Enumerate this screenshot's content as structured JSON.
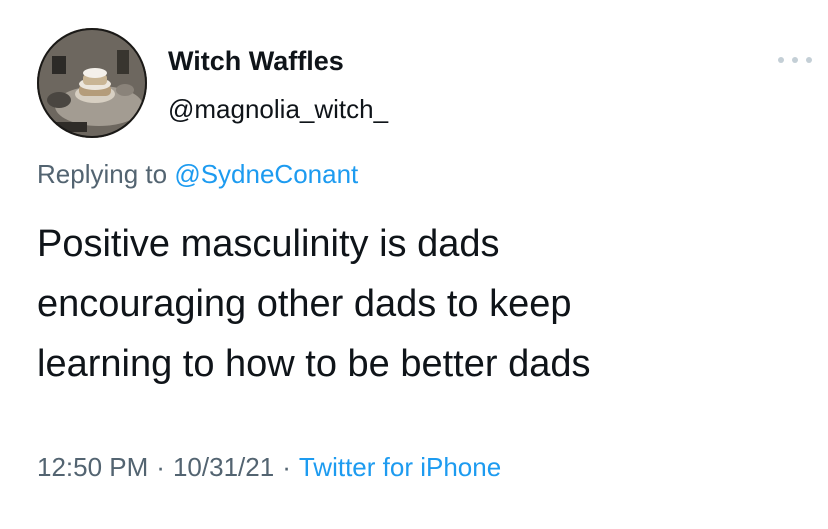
{
  "author": {
    "display_name": "Witch Waffles",
    "handle": "@magnolia_witch_",
    "avatar_icon": "waffle-stack-photo"
  },
  "reply": {
    "prefix": "Replying to",
    "mention": "@SydneConant"
  },
  "tweet": {
    "lines": [
      "Positive masculinity is dads",
      "encouraging other dads to keep",
      "learning to how to be better dads"
    ]
  },
  "meta": {
    "time": "12:50 PM",
    "date": "10/31/21",
    "separator": "·",
    "source": "Twitter for iPhone"
  },
  "icons": {
    "more": "more-horizontal-icon"
  },
  "colors": {
    "link": "#1d9bf0",
    "secondary_text": "#536471",
    "primary_text": "#0f1419",
    "more_dots": "#c4cfd6"
  }
}
